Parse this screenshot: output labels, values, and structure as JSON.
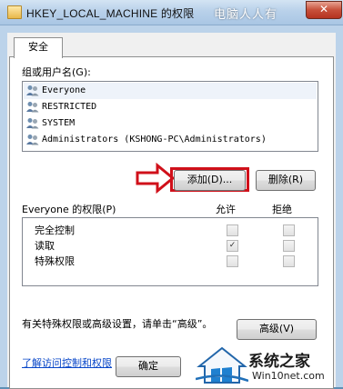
{
  "window": {
    "title": "HKEY_LOCAL_MACHINE 的权限",
    "watermark_top": "电脑人人有",
    "close_label": "✕"
  },
  "tabs": [
    {
      "label": "安全"
    }
  ],
  "group_section": {
    "label": "组或用户名(G):",
    "users": [
      {
        "name": "Everyone",
        "icon": "user-group-icon"
      },
      {
        "name": "RESTRICTED",
        "icon": "user-group-icon"
      },
      {
        "name": "SYSTEM",
        "icon": "user-group-icon"
      },
      {
        "name": "Administrators (KSHONG-PC\\Administrators)",
        "icon": "user-group-icon"
      }
    ],
    "add_button": "添加(D)...",
    "remove_button": "删除(R)"
  },
  "permissions": {
    "label": "Everyone 的权限(P)",
    "allow_header": "允许",
    "deny_header": "拒绝",
    "rows": [
      {
        "name": "完全控制",
        "allow": false,
        "deny": false
      },
      {
        "name": "读取",
        "allow": true,
        "deny": false
      },
      {
        "name": "特殊权限",
        "allow": false,
        "deny": false
      }
    ]
  },
  "advanced": {
    "text": "有关特殊权限或高级设置，请单击“高级”。",
    "button": "高级(V)"
  },
  "link": "了解访问控制和权限",
  "footer": {
    "ok_button": "确定"
  },
  "watermark_bottom": {
    "brand": "系统之家",
    "url": "Win10net.com"
  },
  "colors": {
    "highlight": "#d0101a",
    "link": "#0645c8"
  }
}
